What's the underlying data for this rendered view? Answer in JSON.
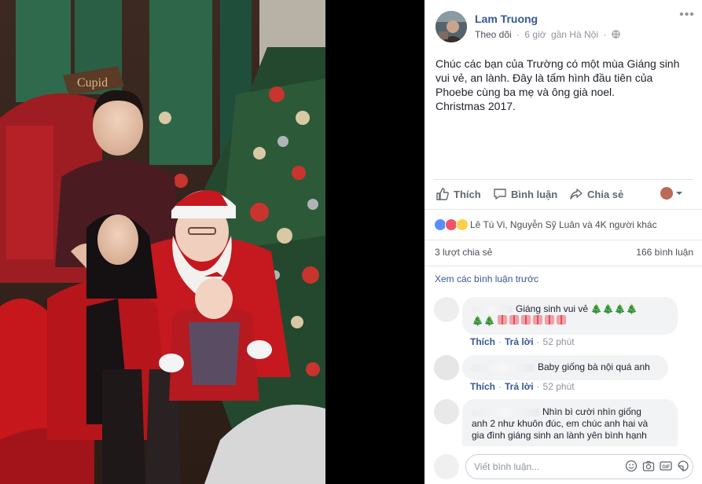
{
  "post": {
    "author": "Lam Truong",
    "follow": "Theo dõi",
    "sep": "·",
    "time": "6 giờ",
    "location": "gần Hà Nội",
    "audience_icon": "globe-icon",
    "more_icon": "ellipsis-icon",
    "text_lines": [
      "Chúc các bạn của Trường có một mùa Giáng sinh",
      "vui vẻ, an lành. Đây là tấm hình đầu tiên của",
      "Phoebe cùng ba mẹ và ông già noel.",
      "Christmas 2017."
    ]
  },
  "actions": {
    "like": "Thích",
    "comment": "Bình luận",
    "share": "Chia sẻ"
  },
  "reactions": {
    "text": "Lê Tú Vi, Nguyễn Sỹ Luân và 4K người khác",
    "icons": [
      "like-icon",
      "love-icon",
      "haha-icon"
    ]
  },
  "stats": {
    "shares": "3 lượt chia sẻ",
    "comments": "166 bình luận"
  },
  "prev_comments": "Xem các bình luận trước",
  "comments": [
    {
      "text": "Giáng sinh vui vẻ",
      "like": "Thích",
      "reply": "Trả lời",
      "time": "52 phút"
    },
    {
      "text": "Baby giống bà nội quá anh",
      "like": "Thích",
      "reply": "Trả lời",
      "time": "52 phút"
    },
    {
      "lines": [
        "Nhìn bì cười nhìn giống",
        "anh 2 như khuôn đúc, em chúc anh hai và",
        "gia đình giáng sinh an lành yên bình hạnh"
      ]
    }
  ],
  "composer": {
    "placeholder": "Viết bình luận..."
  },
  "photo": {
    "sign": "Cupid"
  },
  "colors": {
    "link": "#365899",
    "like_blue": "#5890ff",
    "love_red": "#f25268",
    "haha_yellow": "#fccf47"
  }
}
